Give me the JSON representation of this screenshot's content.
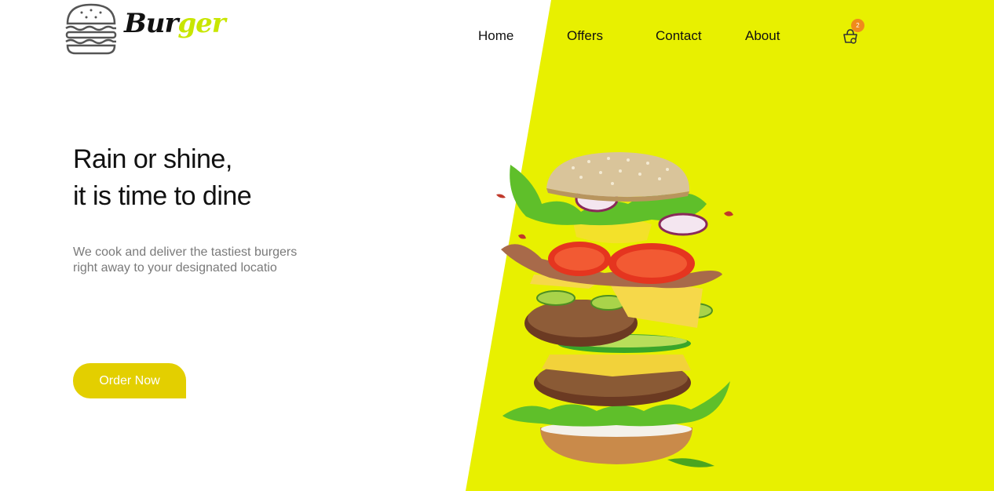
{
  "brand": {
    "name_part1": "Bur",
    "name_part2": "ger",
    "accent_color": "#e8f000",
    "logo_icon": "burger-icon"
  },
  "nav": {
    "items": [
      {
        "label": "Home"
      },
      {
        "label": "Offers"
      },
      {
        "label": "Contact"
      },
      {
        "label": "About"
      }
    ]
  },
  "cart": {
    "icon": "shopping-basket-icon",
    "badge_count": "2",
    "badge_color": "#f08a1c"
  },
  "hero": {
    "headline_line1": "Rain or shine,",
    "headline_line2": "it is time to dine",
    "subtext_line1": "We cook and deliver the tastiest burgers",
    "subtext_line2": "right away to your designated locatio",
    "cta_label": "Order Now",
    "cta_color": "#e3cf00",
    "hero_image": "exploded-burger-image"
  }
}
